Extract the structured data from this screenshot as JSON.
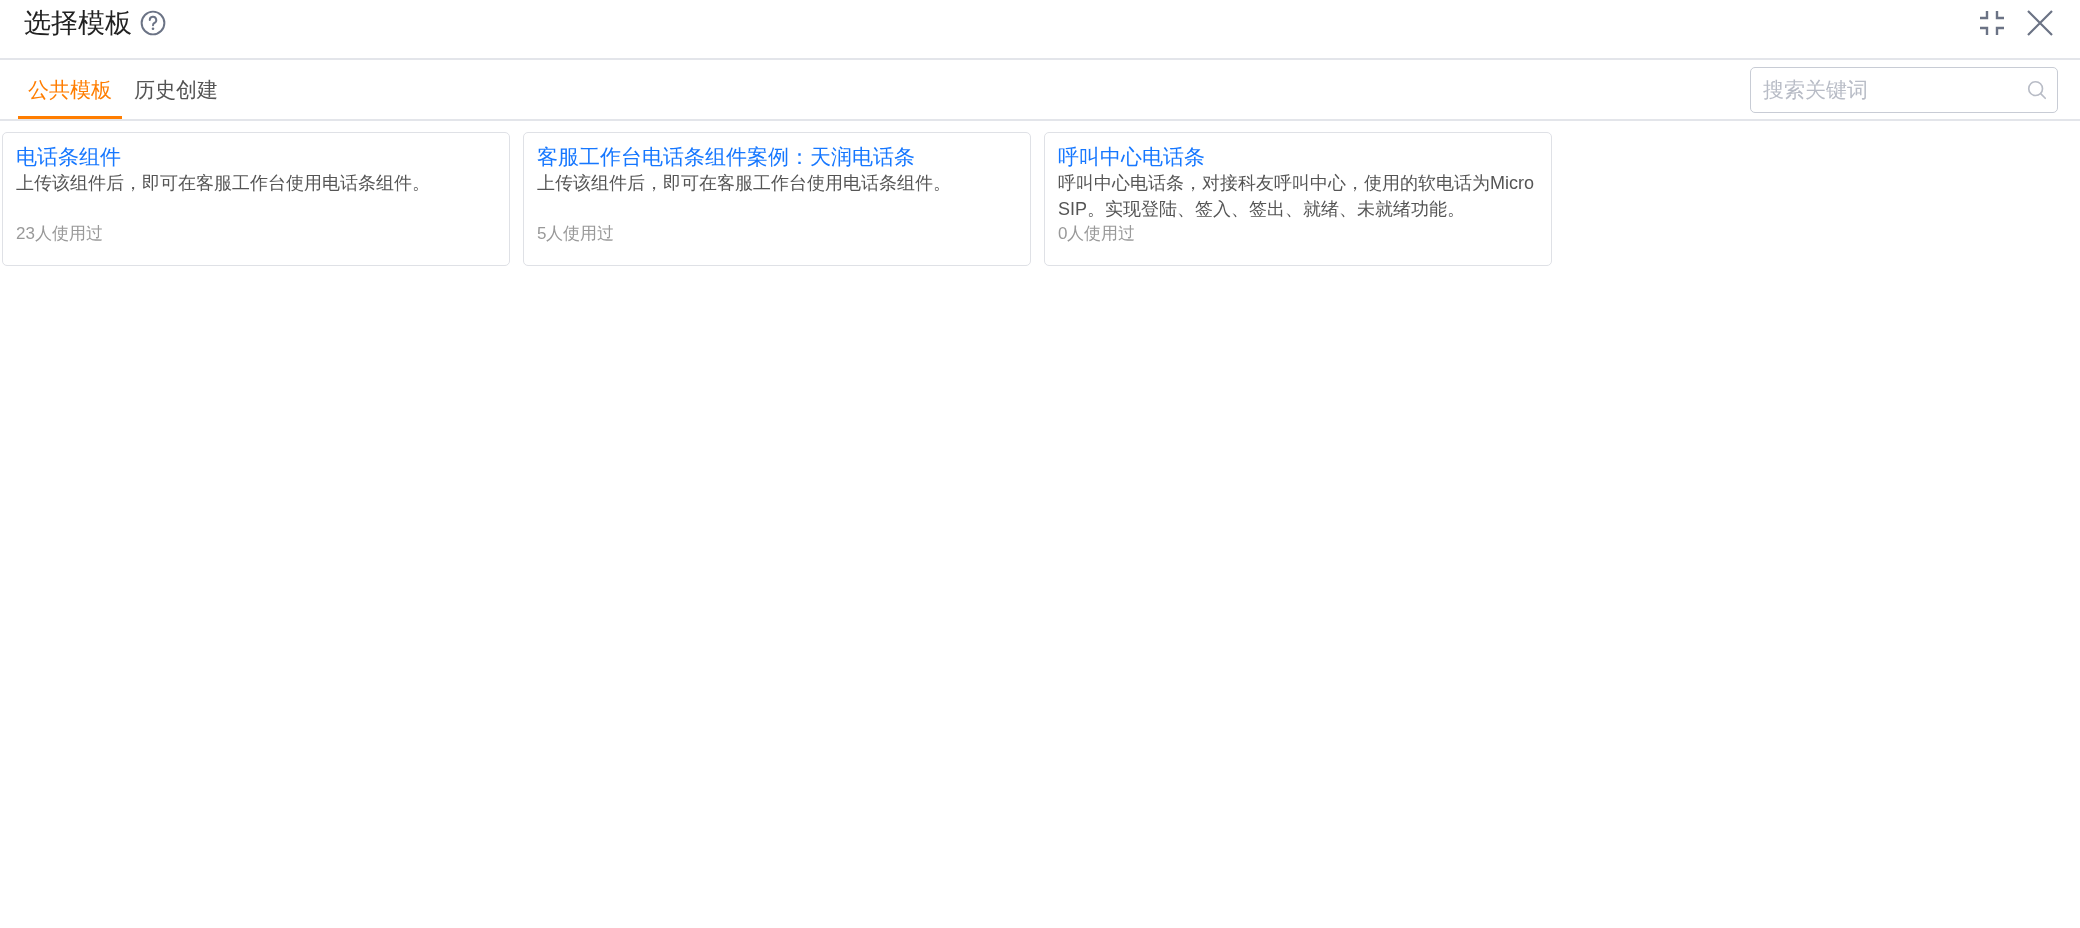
{
  "window": {
    "title": "选择模板"
  },
  "tabs": [
    {
      "label": "公共模板",
      "selected": true
    },
    {
      "label": "历史创建",
      "selected": false
    }
  ],
  "search": {
    "placeholder": "搜索关键词"
  },
  "templates": [
    {
      "title": "电话条组件",
      "description": "上传该组件后，即可在客服工作台使用电话条组件。",
      "usage": "23人使用过"
    },
    {
      "title": "客服工作台电话条组件案例：天润电话条",
      "description": "上传该组件后，即可在客服工作台使用电话条组件。",
      "usage": "5人使用过"
    },
    {
      "title": "呼叫中心电话条",
      "description": "呼叫中心电话条，对接科友呼叫中心，使用的软电话为MicroSIP。实现登陆、签入、签出、就绪、未就绪功能。",
      "usage": "0人使用过"
    }
  ]
}
